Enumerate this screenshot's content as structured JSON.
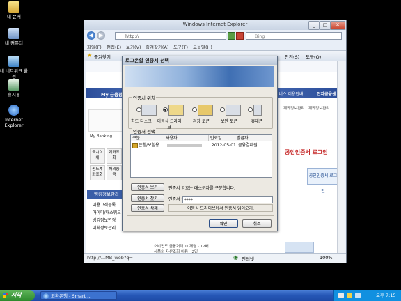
{
  "desktop": {
    "icons": [
      {
        "label": "내 문서",
        "icon": "folder-icon"
      },
      {
        "label": "내 컴퓨터",
        "icon": "computer-icon"
      },
      {
        "label": "내 네트워크 환경",
        "icon": "network-icon"
      },
      {
        "label": "휴지통",
        "icon": "recycle-bin-icon"
      },
      {
        "label": "Internet Explorer",
        "icon": "ie-icon"
      }
    ]
  },
  "browser": {
    "title": "Windows Internet Explorer",
    "address_prefix": "http://",
    "search_placeholder": "Bing",
    "menu": [
      "파일(F)",
      "편집(E)",
      "보기(V)",
      "즐겨찾기(A)",
      "도구(T)",
      "도움말(H)"
    ],
    "favorites_label": "즐겨찾기",
    "right_tools": [
      "안전(S)",
      "도구(O)"
    ],
    "status_url": "http://...MB_web?q=",
    "status_zone": "인터넷",
    "zoom": "100%"
  },
  "page": {
    "my_finance": "My 금융정보",
    "service_info": "서비스 이용안내",
    "e_finance": "전자금융센터",
    "left_menu": [
      "My Banking",
      "즉시이체",
      "계좌조회",
      "펀드계좌조회",
      "해외송금"
    ],
    "bank_info": "뱅킹정보관리",
    "left_links": [
      "이용고객등록",
      "아이디/패스워드",
      "뱅킹정보변경",
      "이체정보관리"
    ],
    "right_links": [
      "계좌정보관리",
      "계좌정보관리"
    ],
    "cert_login_title": "공인인증서 로그인",
    "cert_login_button": "공인인증서 로그인",
    "bottom_bullets": [
      "소비펀드 금융거래 10개월 - 12배",
      "상품의 자산조회 이용 - 2일"
    ]
  },
  "dialog": {
    "title": "로그온할 인증서 선택",
    "location_group": "인증서 위치",
    "locations": [
      {
        "label": "하드 디스크",
        "selected": false
      },
      {
        "label": "이동식 드라이브",
        "selected": true
      },
      {
        "label": "저장 토큰",
        "selected": false
      },
      {
        "label": "보안 토큰",
        "selected": false
      },
      {
        "label": "휴대폰",
        "selected": false
      }
    ],
    "select_group": "인증서 선택",
    "columns": [
      "구분",
      "사용자",
      "만료일",
      "발급자"
    ],
    "rows": [
      {
        "type": "은행/보험용",
        "user": "",
        "expiry": "2012-05-01",
        "issuer": "금융결제원"
      }
    ],
    "buttons": {
      "view": "인증서 보기",
      "find": "인증서 찾기",
      "delete": "인증서 삭제",
      "ok": "확인",
      "cancel": "취소"
    },
    "case_hint": "인증서 암호는 대소문자를 구분합니다.",
    "password_label": "인증서 암호",
    "password_value": "****",
    "status_text": "이동식 드라이브에서 인증서 읽어오기."
  },
  "taskbar": {
    "start": "시작",
    "task": "외환은행 - Smart ...",
    "clock": "오후 7:15"
  }
}
